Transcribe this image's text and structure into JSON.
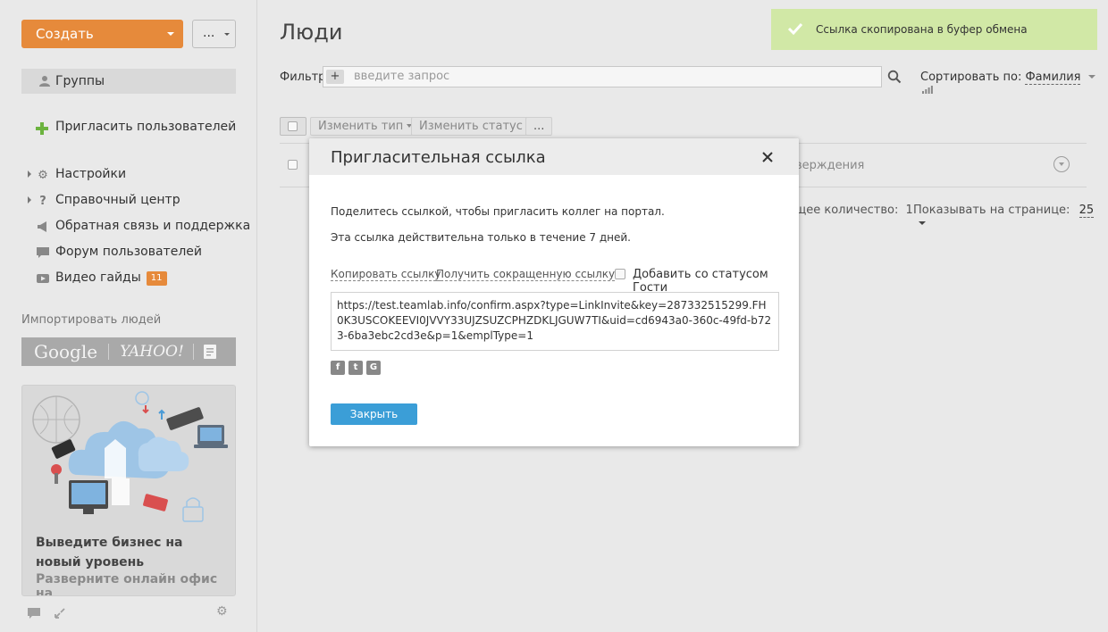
{
  "sidebar": {
    "create_label": "Создать",
    "more_label": "...",
    "groups_label": "Группы",
    "invite_label": "Пригласить пользователей",
    "menu": [
      {
        "label": "Настройки",
        "icon": "gear-icon"
      },
      {
        "label": "Справочный центр",
        "icon": "question-icon"
      },
      {
        "label": "Обратная связь и поддержка",
        "icon": "megaphone-icon"
      },
      {
        "label": "Форум пользователей",
        "icon": "speech-bubble-icon"
      },
      {
        "label": "Видео гайды",
        "icon": "video-icon",
        "badge": "11"
      }
    ],
    "import_title": "Импортировать людей",
    "import_google": "Google",
    "import_yahoo": "YAHOO!",
    "promo_title": "Выведите бизнес на новый уровень",
    "promo_subtitle": "Разверните онлайн офис на"
  },
  "main": {
    "title": "Люди",
    "filter_label": "Фильтр",
    "filter_placeholder": "введите запрос",
    "sort_label": "Сортировать по:",
    "sort_value": "Фамилия",
    "toolbar": {
      "change_type": "Изменить тип",
      "change_status": "Изменить статус",
      "more": "..."
    },
    "row_text": "верждения",
    "total_label": "щее количество:",
    "total_value": "1",
    "per_page_label": "Показывать на странице:",
    "per_page_value": "25"
  },
  "toast": {
    "text": "Ссылка скопирована в буфер обмена"
  },
  "modal": {
    "title": "Пригласительная ссылка",
    "desc1": "Поделитесь ссылкой, чтобы пригласить коллег на портал.",
    "desc2": "Эта ссылка действительна только в течение 7 дней.",
    "copy_link": "Копировать ссылку",
    "short_link": "Получить сокращенную ссылку",
    "guest_label": "Добавить со статусом Гости",
    "link_text": "https://test.teamlab.info/confirm.aspx?type=LinkInvite&key=287332515299.FH0K3USCOKEEVI0JVVY33UJZSUZCPHZDKLJGUW7TI&uid=cd6943a0-360c-49fd-b723-6ba3ebc2cd3e&p=1&emplType=1",
    "share_icons": [
      "facebook-icon",
      "twitter-icon",
      "google-icon"
    ],
    "close_label": "Закрыть"
  },
  "colors": {
    "accent_orange": "#e68a3b",
    "button_blue": "#3b9ed7",
    "toast_green": "#d1e8a6"
  }
}
